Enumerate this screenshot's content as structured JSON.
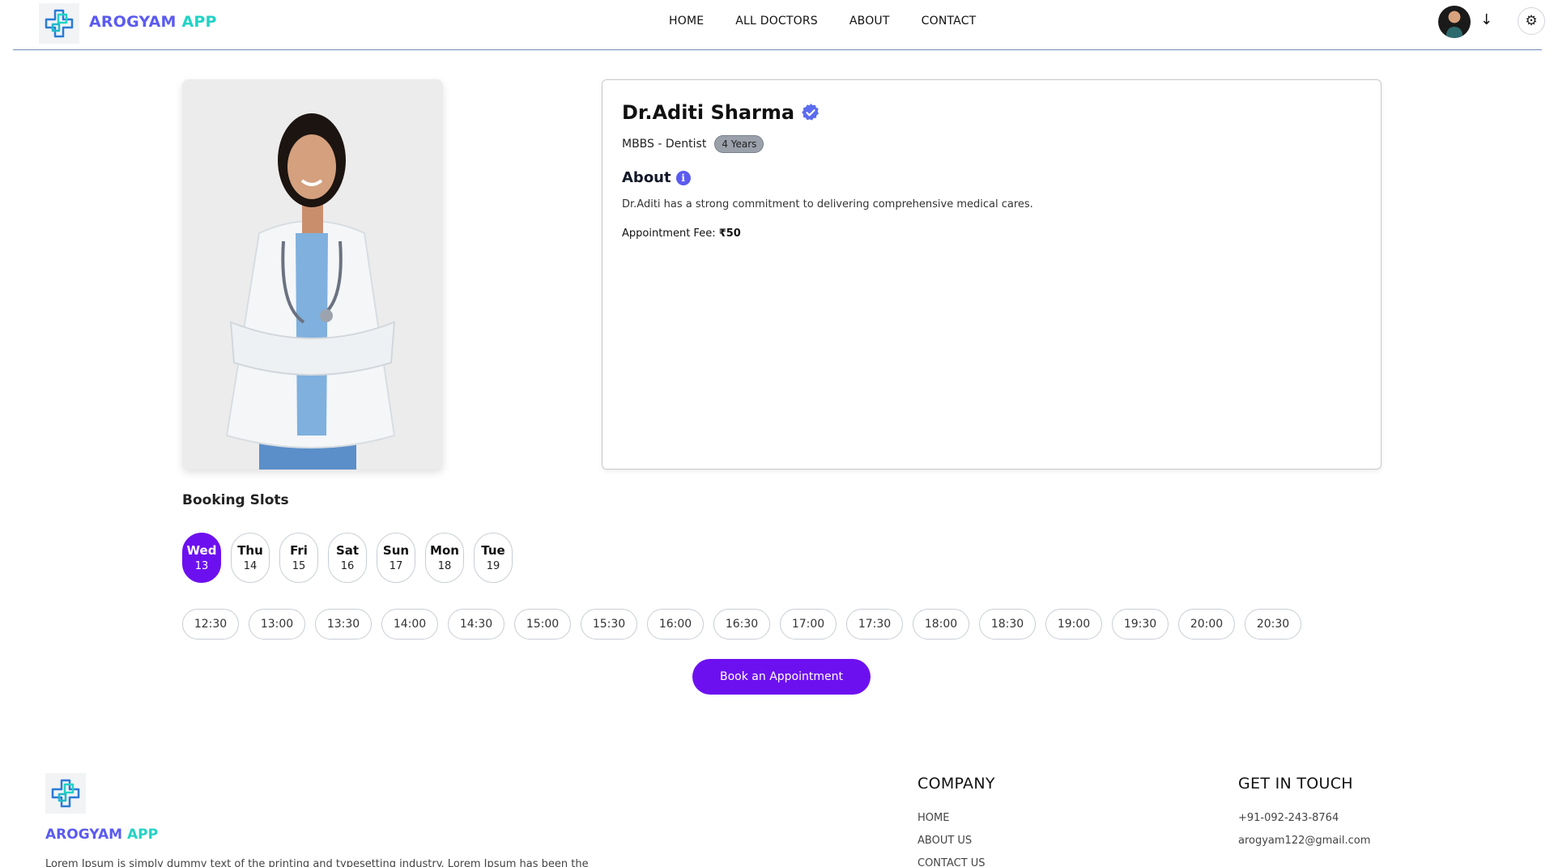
{
  "brand": {
    "part1": "AROGYAM",
    "part2": " APP",
    "color1": "#5b5bf0",
    "color2": "#22d3c5"
  },
  "nav": {
    "links": [
      "HOME",
      "ALL DOCTORS",
      "ABOUT",
      "CONTACT"
    ]
  },
  "header_icons": {
    "arrow": "↓",
    "arrow_icon": "arrow-down-icon",
    "settings_icon": "gear-icon",
    "settings": "⚙"
  },
  "doctor": {
    "name": "Dr.Aditi Sharma",
    "degree": "MBBS - Dentist",
    "experience": "4 Years",
    "about_title": "About",
    "about_text": "Dr.Aditi has a strong commitment to delivering comprehensive medical cares.",
    "fee_label": "Appointment Fee:",
    "fee_value": "₹50"
  },
  "booking": {
    "title": "Booking Slots",
    "days": [
      {
        "name": "Wed",
        "num": "13",
        "active": true
      },
      {
        "name": "Thu",
        "num": "14",
        "active": false
      },
      {
        "name": "Fri",
        "num": "15",
        "active": false
      },
      {
        "name": "Sat",
        "num": "16",
        "active": false
      },
      {
        "name": "Sun",
        "num": "17",
        "active": false
      },
      {
        "name": "Mon",
        "num": "18",
        "active": false
      },
      {
        "name": "Tue",
        "num": "19",
        "active": false
      }
    ],
    "times": [
      "12:30",
      "13:00",
      "13:30",
      "14:00",
      "14:30",
      "15:00",
      "15:30",
      "16:00",
      "16:30",
      "17:00",
      "17:30",
      "18:00",
      "18:30",
      "19:00",
      "19:30",
      "20:00",
      "20:30"
    ],
    "button": "Book an Appointment",
    "accent": "#6d10f0"
  },
  "footer": {
    "brand_part1": "AROGYAM",
    "brand_part2": " APP",
    "description": "Lorem Ipsum is simply dummy text of the printing and typesetting industry. Lorem Ipsum has been the",
    "company_title": "COMPANY",
    "company_links": [
      "HOME",
      "ABOUT US",
      "CONTACT US"
    ],
    "touch_title": "GET IN TOUCH",
    "touch_items": [
      "+91-092-243-8764",
      "arogyam122@gmail.com"
    ]
  }
}
